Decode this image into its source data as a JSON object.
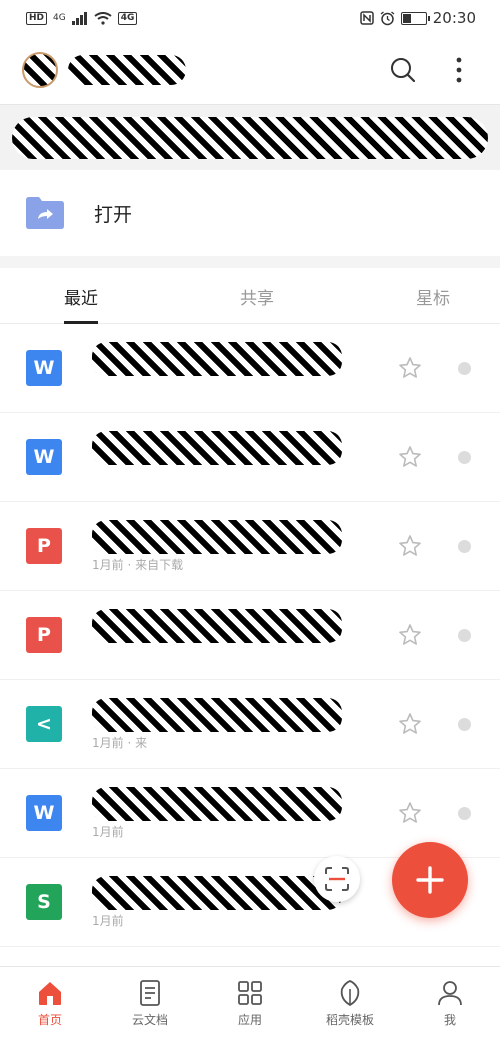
{
  "status_bar": {
    "hd": "HD",
    "network": "4G",
    "carrier_badge": "4G",
    "time": "20:30"
  },
  "header": {
    "user_name": ""
  },
  "banner": {
    "text": ""
  },
  "open": {
    "label": "打开"
  },
  "tabs": [
    {
      "label": "最近",
      "active": true
    },
    {
      "label": "共享",
      "active": false
    },
    {
      "label": "星标",
      "active": false
    }
  ],
  "files": [
    {
      "type": "writer",
      "type_letter": "W",
      "type_color": "#3e86ef",
      "name": "",
      "meta": ""
    },
    {
      "type": "writer",
      "type_letter": "W",
      "type_color": "#3e86ef",
      "name": "",
      "meta": ""
    },
    {
      "type": "pdf",
      "type_letter": "P",
      "type_color": "#e9524a",
      "name": "",
      "meta": "1月前 · 来自下载"
    },
    {
      "type": "pdf",
      "type_letter": "P",
      "type_color": "#e9524a",
      "name": "",
      "meta": ""
    },
    {
      "type": "share",
      "type_letter": "<",
      "type_color": "#20b1a8",
      "name": "",
      "meta": "1月前 · 来"
    },
    {
      "type": "writer",
      "type_letter": "W",
      "type_color": "#3e86ef",
      "name": "",
      "meta": "1月前"
    },
    {
      "type": "sheet",
      "type_letter": "S",
      "type_color": "#22a55b",
      "name": "",
      "meta": "1月前"
    }
  ],
  "bottom_nav": [
    {
      "label": "首页",
      "icon": "home-icon",
      "active": true
    },
    {
      "label": "云文档",
      "icon": "document-icon",
      "active": false
    },
    {
      "label": "应用",
      "icon": "apps-grid-icon",
      "active": false
    },
    {
      "label": "稻壳模板",
      "icon": "leaf-icon",
      "active": false
    },
    {
      "label": "我",
      "icon": "user-icon",
      "active": false
    }
  ],
  "colors": {
    "accent": "#ec4f3c",
    "folder": "#8aa2e8",
    "text": "#222222",
    "muted": "#999999"
  }
}
